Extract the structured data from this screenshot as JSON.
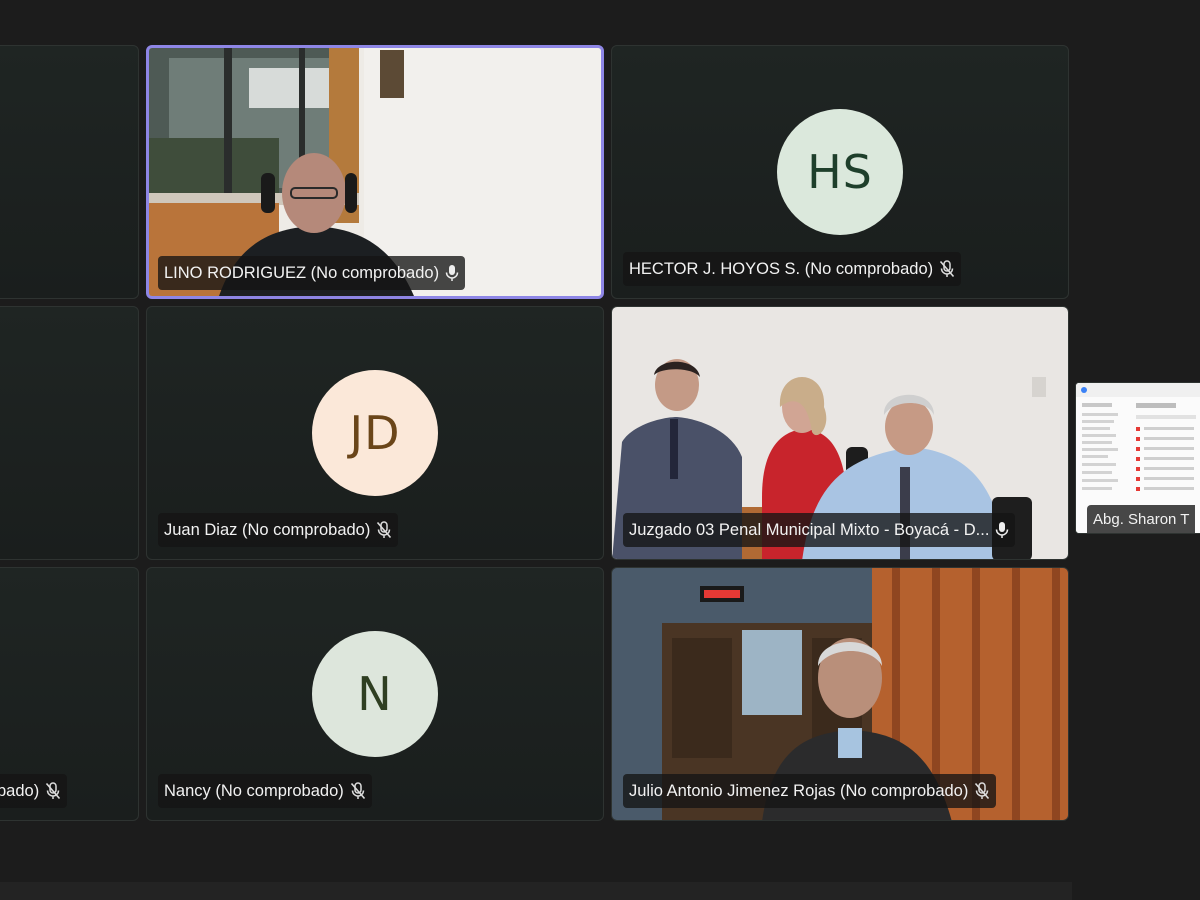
{
  "participants": [
    {
      "id": "partial-1",
      "label": ""
    },
    {
      "id": "lino",
      "label": "LINO RODRIGUEZ (No comprobado)",
      "mic": "mic-on",
      "active": true
    },
    {
      "id": "hector",
      "label": "HECTOR J. HOYOS S. (No comprobado)",
      "mic": "mic-muted",
      "initials": "HS"
    },
    {
      "id": "partial-2",
      "label": ""
    },
    {
      "id": "juan",
      "label": "Juan Diaz (No comprobado)",
      "mic": "mic-muted",
      "initials": "JD"
    },
    {
      "id": "juzgado",
      "label": "Juzgado 03 Penal Municipal Mixto - Boyacá - D...",
      "mic": "mic-on"
    },
    {
      "id": "sharon",
      "label": "Abg. Sharon T"
    },
    {
      "id": "partial-3",
      "label": "bado)",
      "mic": "mic-muted"
    },
    {
      "id": "nancy",
      "label": "Nancy (No comprobado)",
      "mic": "mic-muted",
      "initials": "N"
    },
    {
      "id": "julio",
      "label": "Julio Antonio Jimenez Rojas (No comprobado)",
      "mic": "mic-muted"
    }
  ],
  "colors": {
    "active_border": "#8e86e6",
    "hs_avatar_bg": "#dbe8dc",
    "hs_avatar_fg": "#1e3f2b",
    "jd_avatar_bg": "#fbe8d9",
    "jd_avatar_fg": "#6a4519",
    "n_avatar_bg": "#dde6dc",
    "n_avatar_fg": "#2f3f22"
  }
}
